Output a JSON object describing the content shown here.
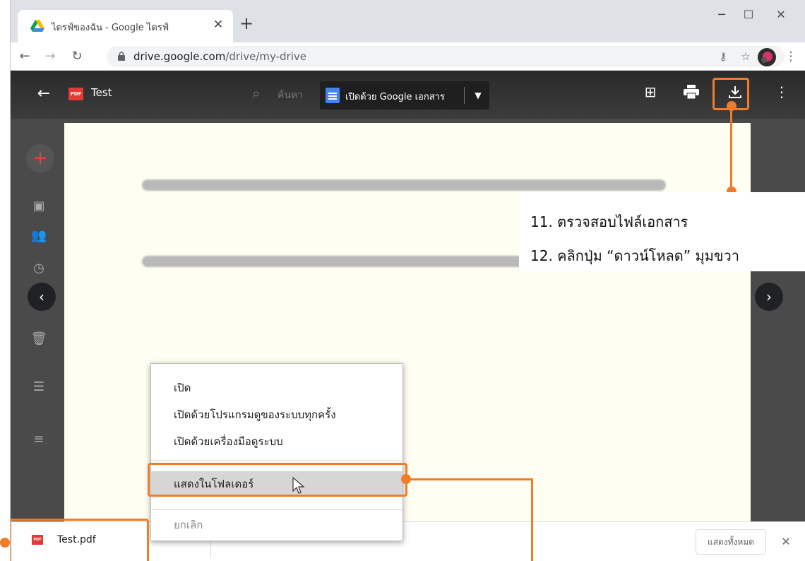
{
  "browser": {
    "tab_title": "ไดรฟ์ของฉัน - Google ไดรฟ์",
    "url_host": "drive.google.com",
    "url_path": "/drive/my-drive"
  },
  "viewer": {
    "file_name": "Test",
    "pdf_badge": "PDF",
    "open_with_label": "เปิดด้วย Google เอกสาร",
    "search_ghost": "ค้นหา"
  },
  "annotation": {
    "step11": "11. ตรวจสอบไฟล์เอกสาร",
    "step12": "12. คลิกปุ่ม “ดาวน์โหลด” มุมขวา"
  },
  "context_menu": {
    "items": [
      {
        "label": "เปิด"
      },
      {
        "label": "เปิดด้วยโปรแกรมดูของระบบทุกครั้ง"
      },
      {
        "label": "เปิดด้วยเครื่องมือดูระบบ"
      },
      {
        "label": "แสดงในโฟลเดอร์"
      },
      {
        "label": "ยกเลิก"
      }
    ],
    "highlighted_index": 3
  },
  "download_shelf": {
    "file_name": "Test.pdf",
    "pdf_badge": "PDF",
    "show_all_label": "แสดงทั้งหมด"
  },
  "colors": {
    "annotation": "#f07c29",
    "drive_blue": "#4285f4",
    "pdf_red": "#e53935"
  }
}
